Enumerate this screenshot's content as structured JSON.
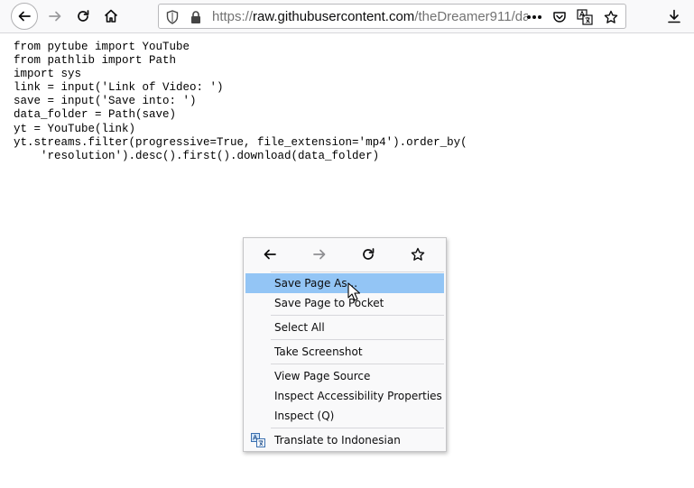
{
  "browser": {
    "url_scheme": "https://",
    "url_domain": "raw.githubusercontent.com",
    "url_path": "/theDreamer911/dar"
  },
  "code_lines": [
    "from pytube import YouTube",
    "from pathlib import Path",
    "import sys",
    "link = input('Link of Video: ')",
    "save = input('Save into: ')",
    "data_folder = Path(save)",
    "yt = YouTube(link)",
    "yt.streams.filter(progressive=True, file_extension='mp4').order_by(",
    "    'resolution').desc().first().download(data_folder)"
  ],
  "context_menu": {
    "save_page_as": "Save Page As...",
    "save_to_pocket": "Save Page to Pocket",
    "select_all": "Select All",
    "take_screenshot": "Take Screenshot",
    "view_source": "View Page Source",
    "inspect_accessibility": "Inspect Accessibility Properties",
    "inspect": "Inspect (Q)",
    "translate": "Translate to Indonesian"
  },
  "colors": {
    "highlight": "#93c5f5",
    "toolbar": "#f9f9fa"
  }
}
